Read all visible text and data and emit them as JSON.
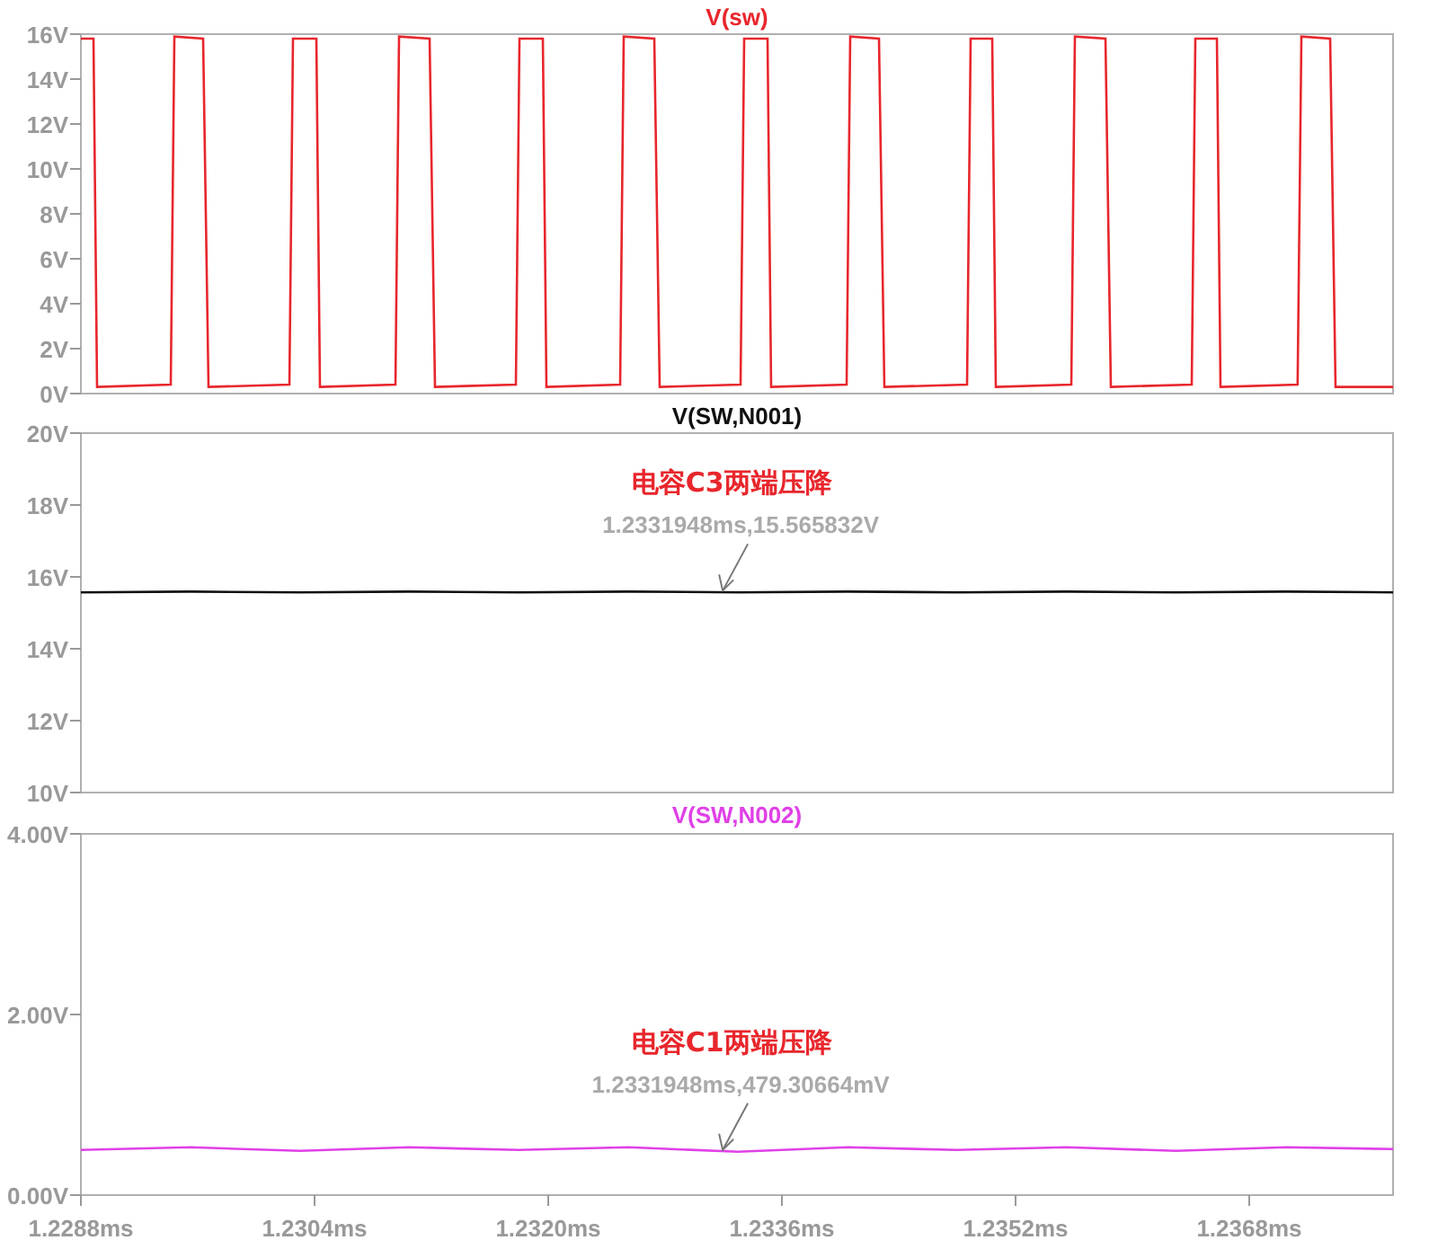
{
  "charts": [
    {
      "chart_data": {
        "type": "line",
        "xlim": [
          1.2288,
          1.237785
        ],
        "ylim": [
          0,
          16
        ],
        "yticks": [
          {
            "value": 0,
            "label": "0V"
          },
          {
            "value": 2,
            "label": "2V"
          },
          {
            "value": 4,
            "label": "4V"
          },
          {
            "value": 6,
            "label": "6V"
          },
          {
            "value": 8,
            "label": "8V"
          },
          {
            "value": 10,
            "label": "10V"
          },
          {
            "value": 12,
            "label": "12V"
          },
          {
            "value": 14,
            "label": "14V"
          },
          {
            "value": 16,
            "label": "16V"
          }
        ],
        "x": [
          1.2288,
          1.228886,
          1.228911,
          1.229415,
          1.22944,
          1.229637,
          1.229674,
          1.230228,
          1.230252,
          1.230412,
          1.230437,
          1.230954,
          1.230978,
          1.231188,
          1.231225,
          1.231778,
          1.231803,
          1.231963,
          1.231988,
          1.232492,
          1.232517,
          1.232726,
          1.232763,
          1.233317,
          1.233342,
          1.233502,
          1.233526,
          1.234043,
          1.234068,
          1.234265,
          1.234302,
          1.234868,
          1.234892,
          1.23504,
          1.235065,
          1.235582,
          1.235606,
          1.235816,
          1.235852,
          1.236406,
          1.236431,
          1.236579,
          1.236603,
          1.237132,
          1.237157,
          1.237354,
          1.237391,
          1.237785
        ],
        "series": [
          {
            "name": "V(sw)",
            "color": "#e8262c",
            "values": [
              15.8,
              15.8,
              0.3,
              0.4,
              15.9,
              15.8,
              0.3,
              0.4,
              15.8,
              15.8,
              0.3,
              0.4,
              15.9,
              15.8,
              0.3,
              0.4,
              15.8,
              15.8,
              0.3,
              0.4,
              15.9,
              15.8,
              0.3,
              0.4,
              15.8,
              15.8,
              0.3,
              0.4,
              15.9,
              15.8,
              0.3,
              0.4,
              15.8,
              15.8,
              0.3,
              0.4,
              15.9,
              15.8,
              0.3,
              0.4,
              15.8,
              15.8,
              0.3,
              0.4,
              15.9,
              15.8,
              0.3,
              0.3
            ]
          }
        ]
      }
    },
    {
      "chart_data": {
        "type": "line",
        "xlim": [
          1.2288,
          1.237785
        ],
        "ylim": [
          10,
          20
        ],
        "yticks": [
          {
            "value": 10,
            "label": "10V"
          },
          {
            "value": 12,
            "label": "12V"
          },
          {
            "value": 14,
            "label": "14V"
          },
          {
            "value": 16,
            "label": "16V"
          },
          {
            "value": 18,
            "label": "18V"
          },
          {
            "value": 20,
            "label": "20V"
          }
        ],
        "x": [
          1.2288,
          1.22955,
          1.2303,
          1.23105,
          1.2318,
          1.23255,
          1.2333,
          1.23405,
          1.2348,
          1.23555,
          1.2363,
          1.23705,
          1.237785
        ],
        "series": [
          {
            "name": "V(SW,N001)",
            "color": "#111111",
            "values": [
              15.57,
              15.59,
              15.57,
              15.59,
              15.57,
              15.59,
              15.57,
              15.59,
              15.57,
              15.59,
              15.57,
              15.59,
              15.57
            ]
          }
        ],
        "annotations": [
          "电容C3两端压降",
          {
            "text": "1.2331948ms,15.565832V",
            "x": 1.2331948,
            "y": 15.565832
          }
        ]
      }
    },
    {
      "chart_data": {
        "type": "line",
        "xlim": [
          1.2288,
          1.237785
        ],
        "ylim": [
          0,
          4
        ],
        "yticks": [
          {
            "value": 0,
            "label": "0.00V"
          },
          {
            "value": 2,
            "label": "2.00V"
          },
          {
            "value": 4,
            "label": "4.00V"
          }
        ],
        "xticks": [
          {
            "value": 1.2288,
            "label": "1.2288ms"
          },
          {
            "value": 1.2304,
            "label": "1.2304ms"
          },
          {
            "value": 1.232,
            "label": "1.2320ms"
          },
          {
            "value": 1.2336,
            "label": "1.2336ms"
          },
          {
            "value": 1.2352,
            "label": "1.2352ms"
          },
          {
            "value": 1.2368,
            "label": "1.2368ms"
          }
        ],
        "x": [
          1.2288,
          1.22955,
          1.2303,
          1.23105,
          1.2318,
          1.23255,
          1.2333,
          1.23405,
          1.2348,
          1.23555,
          1.2363,
          1.23705,
          1.237785
        ],
        "series": [
          {
            "name": "V(SW,N002)",
            "color": "#e040e8",
            "values": [
              0.5,
              0.53,
              0.49,
              0.53,
              0.5,
              0.53,
              0.48,
              0.53,
              0.5,
              0.53,
              0.49,
              0.53,
              0.51
            ]
          }
        ],
        "annotations": [
          "电容C1两端压降",
          {
            "text": "1.2331948ms,479.30664mV",
            "x": 1.2331948,
            "y": 0.47930664
          }
        ]
      }
    }
  ]
}
